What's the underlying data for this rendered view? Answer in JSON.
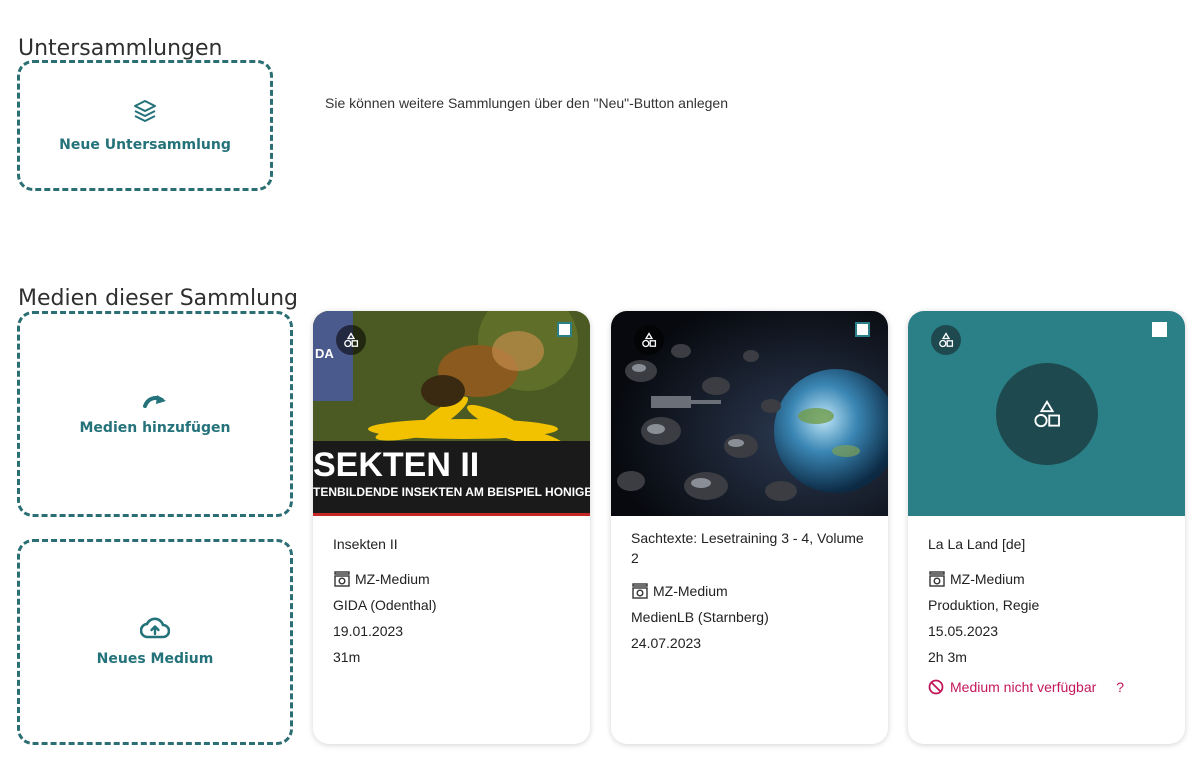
{
  "sections": {
    "subcollections_title": "Untersammlungen",
    "media_title": "Medien dieser Sammlung"
  },
  "subcollections": {
    "new_label": "Neue Untersammlung",
    "hint": "Sie können weitere Sammlungen über den \"Neu\"-Button anlegen"
  },
  "media_actions": {
    "add_label": "Medien hinzufügen",
    "new_label": "Neues Medium"
  },
  "accent_color": "#2b7f86",
  "cards": [
    {
      "title": "Insekten II",
      "type": "MZ-Medium",
      "publisher": "GIDA (Odenthal)",
      "date": "19.01.2023",
      "duration": "31m",
      "thumb_text_1": "SEKTEN II",
      "thumb_text_2": "TENBILDENDE INSEKTEN AM BEISPIEL HONIGB",
      "thumb_logo": "DA"
    },
    {
      "title": "Sachtexte: Lesetraining 3 - 4, Volume 2",
      "type": "MZ-Medium",
      "publisher": "MedienLB (Starnberg)",
      "date": "24.07.2023"
    },
    {
      "title": "La La Land [de]",
      "type": "MZ-Medium",
      "publisher": "Produktion, Regie",
      "date": "15.05.2023",
      "duration": "2h 3m",
      "status": "Medium nicht verfügbar",
      "help": "?"
    }
  ]
}
